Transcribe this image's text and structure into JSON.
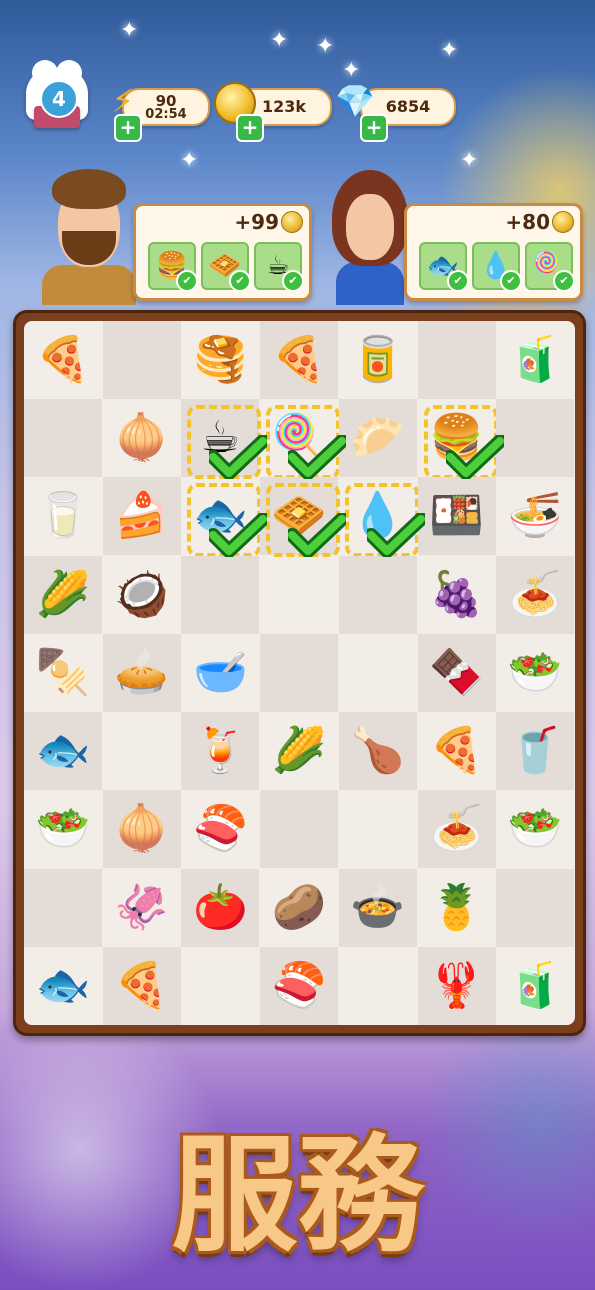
{
  "hud": {
    "level": "4",
    "energy_value": "90",
    "energy_timer": "02:54",
    "coins_value": "123k",
    "gems_value": "6854"
  },
  "orders": [
    {
      "customer": "man",
      "reward": "+99",
      "items": [
        "burger-icon",
        "waffle-icon",
        "tea-icon"
      ]
    },
    {
      "customer": "woman",
      "reward": "+80",
      "items": [
        "grilled-fish-icon",
        "water-bottle-icon",
        "popsicle-icon"
      ]
    }
  ],
  "board": {
    "cols": 7,
    "rows": 9,
    "items": [
      [
        "🍕",
        "",
        "🥞",
        "🍕",
        "🥫",
        "",
        "🧃"
      ],
      [
        "",
        "🧅",
        "☕",
        "🍭",
        "🥟",
        "🍔",
        ""
      ],
      [
        "🥛",
        "🍰",
        "🐟",
        "🧇",
        "💧",
        "🍱",
        "🍜"
      ],
      [
        "🌽",
        "🥥",
        "",
        "",
        "",
        "🍇",
        "🍝"
      ],
      [
        "🍢",
        "🥧",
        "🥣",
        "",
        "",
        "🍫",
        "🥗"
      ],
      [
        "🐟",
        "",
        "🍹",
        "🌽",
        "🍗",
        "🍕",
        "🥤"
      ],
      [
        "🥗",
        "🧅",
        "🍣",
        "",
        "",
        "🍝",
        "🥗"
      ],
      [
        "",
        "🦑",
        "🍅",
        "🥔",
        "🍲",
        "🍍",
        ""
      ],
      [
        "🐟",
        "🍕",
        "",
        "🍣",
        "",
        "🦞",
        "🧃"
      ]
    ],
    "selected": [
      [
        1,
        2
      ],
      [
        1,
        3
      ],
      [
        1,
        5
      ],
      [
        2,
        2
      ],
      [
        2,
        3
      ],
      [
        2,
        4
      ]
    ],
    "checked": [
      [
        1,
        2
      ],
      [
        1,
        3
      ],
      [
        1,
        5
      ],
      [
        2,
        2
      ],
      [
        2,
        3
      ],
      [
        2,
        4
      ]
    ]
  },
  "banner": {
    "title": "服務"
  }
}
